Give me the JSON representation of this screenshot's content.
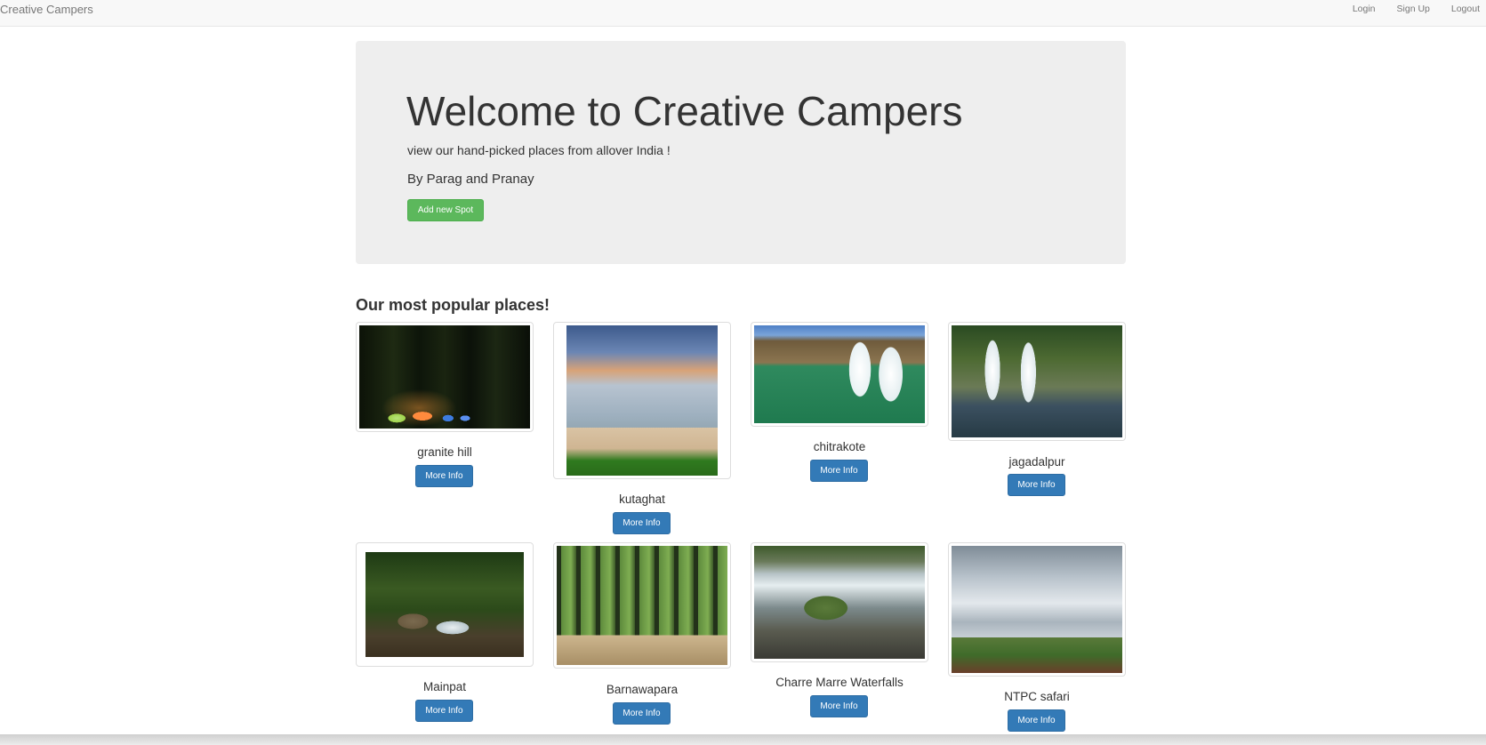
{
  "navbar": {
    "brand": "Creative Campers",
    "links": [
      "Login",
      "Sign Up",
      "Logout"
    ]
  },
  "jumbotron": {
    "title": "Welcome to Creative Campers",
    "subtitle": "view our hand-picked places from allover India !",
    "byline": "By Parag and Pranay",
    "add_button": "Add new Spot"
  },
  "places_section": {
    "title": "Our most popular places!",
    "button_label": "More Info",
    "places": [
      {
        "name": "granite hill"
      },
      {
        "name": "kutaghat"
      },
      {
        "name": "chitrakote"
      },
      {
        "name": "jagadalpur"
      },
      {
        "name": "Mainpat"
      },
      {
        "name": "Barnawapara"
      },
      {
        "name": "Charre Marre Waterfalls"
      },
      {
        "name": "NTPC safari"
      }
    ]
  }
}
